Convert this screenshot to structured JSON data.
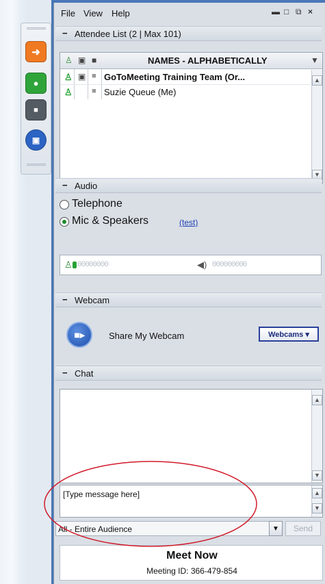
{
  "menu": {
    "file": "File",
    "view": "View",
    "help": "Help"
  },
  "window_controls": [
    "–",
    "□",
    "⧉",
    "×"
  ],
  "grabtab": {
    "buttons": [
      {
        "name": "show-hide-panel-button",
        "icon": "arrow-right-icon",
        "glyph": "→",
        "color": "#f07a22"
      },
      {
        "name": "microphone-button",
        "icon": "microphone-icon",
        "glyph": "🎙",
        "color": "#2fa43a"
      },
      {
        "name": "webcam-toggle-button",
        "icon": "camera-icon",
        "glyph": "■",
        "color": "#555b63"
      },
      {
        "name": "screen-share-button",
        "icon": "screen-icon",
        "glyph": "▣",
        "color": "#2c64c4"
      }
    ]
  },
  "attendee": {
    "section_title": "Attendee List  (2 | Max 101)",
    "column_header": "NAMES - ALPHABETICALLY",
    "rows": [
      {
        "name": "GoToMeeting Training Team (Or...",
        "bold": true
      },
      {
        "name": "Suzie Queue (Me)",
        "bold": false
      }
    ]
  },
  "audio": {
    "section_title": "Audio",
    "telephone_label": "Telephone",
    "mic_label": "Mic & Speakers",
    "test_link": "(test)",
    "selected": "mic",
    "mic_meter": "00000000",
    "speaker_meter": "000000000"
  },
  "webcam": {
    "section_title": "Webcam",
    "share_label": "Share My Webcam",
    "dropdown_label": "Webcams ▾"
  },
  "chat": {
    "section_title": "Chat",
    "placeholder": "[Type message here]",
    "audience": "All - Entire Audience",
    "send_label": "Send"
  },
  "meet_now": {
    "title": "Meet Now",
    "meeting_id": "Meeting ID: 366-479-854"
  },
  "colors": {
    "accent_blue": "#4a78b6",
    "annotation_red": "#d11a2a"
  }
}
